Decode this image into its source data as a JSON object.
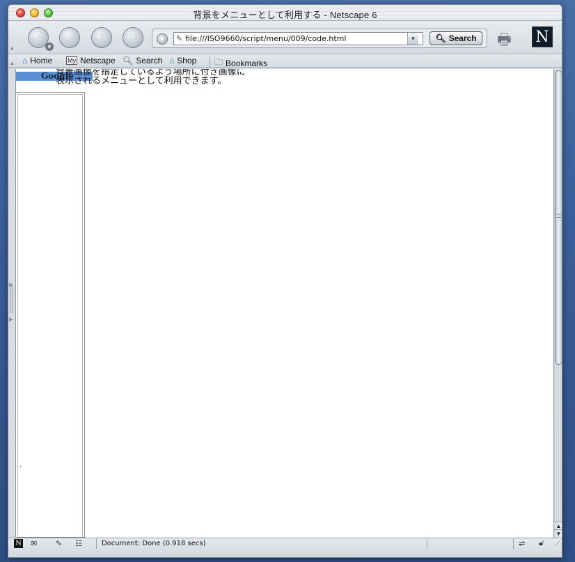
{
  "window": {
    "title": "背景をメニューとして利用する - Netscape 6"
  },
  "toolbar": {
    "back_glyph": "‹",
    "forward_glyph": "›",
    "reload_glyph": "↑",
    "stop_glyph": "×",
    "url": "file:///ISO9660/script/menu/009/code.html",
    "search_label": "Search"
  },
  "bookmarks_bar": {
    "home": "Home",
    "my_box": "My",
    "netscape": "Netscape",
    "search": "Search",
    "shop": "Shop",
    "bookmarks": "Bookmarks"
  },
  "content": {
    "cut_line": "背景画像を指定しているよう場所に付き画像に",
    "line": "表示されるメニューとして利用できます。",
    "google_partial": "Google",
    "dot": "."
  },
  "status": {
    "text": "Document: Done (0.918 secs)"
  },
  "logo": {
    "letter": "N"
  },
  "colors": {
    "page_background": "#3b5f9a",
    "google_bar": "#5b8fd6"
  }
}
